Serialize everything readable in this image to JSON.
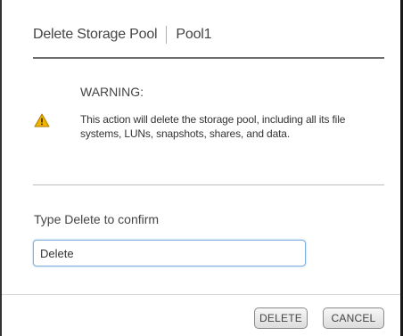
{
  "dialog": {
    "title": "Delete Storage Pool",
    "pool_name": "Pool1"
  },
  "warning": {
    "title": "WARNING:",
    "icon": "warning-triangle-icon",
    "icon_color": "#f0b400",
    "text": "This action will delete the storage pool, including all its file systems, LUNs, snapshots, shares, and data."
  },
  "confirm": {
    "label": "Type Delete to confirm",
    "value": "Delete"
  },
  "buttons": {
    "delete_label": "DELETE",
    "cancel_label": "CANCEL"
  }
}
